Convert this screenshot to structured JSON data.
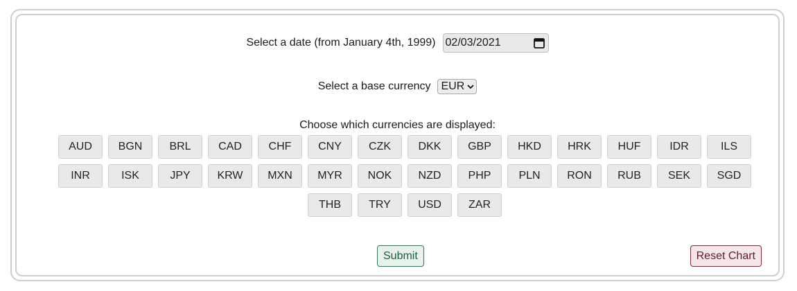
{
  "date_row": {
    "label": "Select a date (from January 4th, 1999)",
    "value": "02/03/2021",
    "icon": "calendar-icon"
  },
  "base_row": {
    "label": "Select a base currency",
    "selected": "EUR",
    "icon": "chevron-down-icon"
  },
  "choose_label": "Choose which currencies are displayed:",
  "currencies": [
    "AUD",
    "BGN",
    "BRL",
    "CAD",
    "CHF",
    "CNY",
    "CZK",
    "DKK",
    "GBP",
    "HKD",
    "HRK",
    "HUF",
    "IDR",
    "ILS",
    "INR",
    "ISK",
    "JPY",
    "KRW",
    "MXN",
    "MYR",
    "NOK",
    "NZD",
    "PHP",
    "PLN",
    "RON",
    "RUB",
    "SEK",
    "SGD",
    "THB",
    "TRY",
    "USD",
    "ZAR"
  ],
  "buttons": {
    "submit": "Submit",
    "reset": "Reset Chart"
  },
  "colors": {
    "submit_border": "#2f7a55",
    "reset_border": "#7a2f3a"
  }
}
